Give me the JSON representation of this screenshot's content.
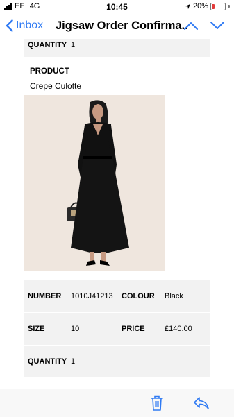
{
  "status_bar": {
    "carrier": "EE",
    "network": "4G",
    "time": "10:45",
    "battery_percent": "20%",
    "battery_level": 0.2
  },
  "nav": {
    "back_label": "Inbox",
    "title": "Jigsaw Order Confirma..."
  },
  "email": {
    "top_row": {
      "label": "QUANTITY",
      "value": "1"
    },
    "product_heading": "PRODUCT",
    "product_name": "Crepe Culotte",
    "details": [
      {
        "left_label": "NUMBER",
        "left_value": "1010J41213",
        "right_label": "COLOUR",
        "right_value": "Black"
      },
      {
        "left_label": "SIZE",
        "left_value": "10",
        "right_label": "PRICE",
        "right_value": "£140.00"
      },
      {
        "left_label": "QUANTITY",
        "left_value": "1",
        "right_label": "",
        "right_value": ""
      }
    ]
  },
  "colors": {
    "accent": "#2f7af3",
    "table_bg": "#f2f2f2",
    "battery_low": "#e23b3b"
  }
}
